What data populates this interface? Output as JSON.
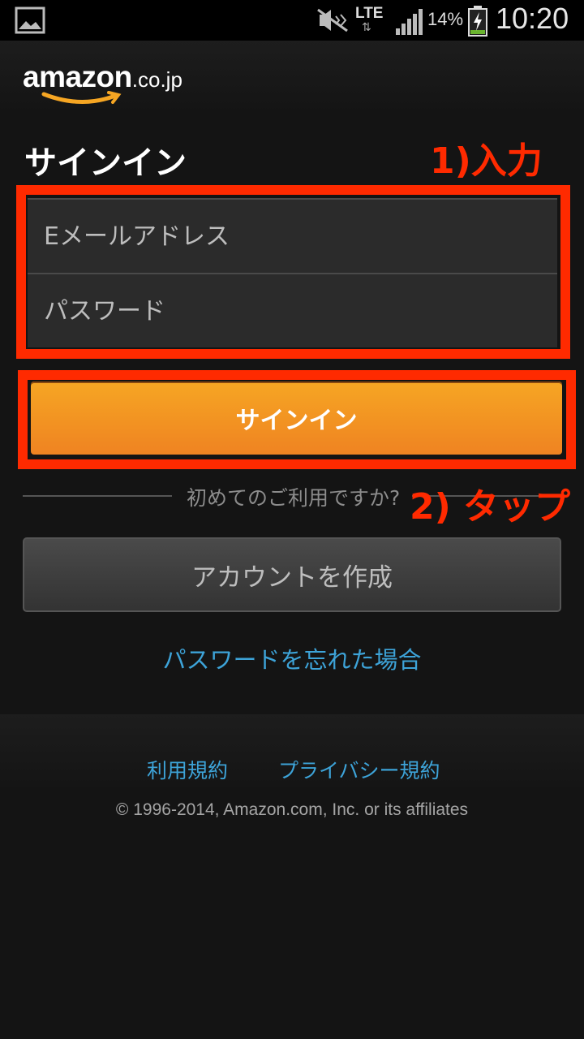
{
  "status_bar": {
    "network": "LTE",
    "battery_percent": "14%",
    "time": "10:20",
    "icons": [
      "gallery-icon",
      "mute-icon",
      "signal-icon",
      "battery-charging-icon"
    ]
  },
  "header": {
    "logo_word": "amazon",
    "logo_tld": ".co.jp"
  },
  "page": {
    "title": "サインイン"
  },
  "annotations": {
    "step1": "1)入力",
    "step2": "2) タップ",
    "highlight_color": "#ff2a00"
  },
  "form": {
    "email_placeholder": "Eメールアドレス",
    "password_placeholder": "パスワード",
    "signin_label": "サインイン"
  },
  "new_user": {
    "divider_text": "初めてのご利用ですか?",
    "create_account_label": "アカウントを作成"
  },
  "forgot_password_label": "パスワードを忘れた場合",
  "footer": {
    "terms_label": "利用規約",
    "privacy_label": "プライバシー規約",
    "copyright": "© 1996-2014, Amazon.com, Inc. or its affiliates"
  },
  "colors": {
    "background": "#141414",
    "accent_orange": "#f6a623",
    "link_blue": "#3da3d8"
  }
}
